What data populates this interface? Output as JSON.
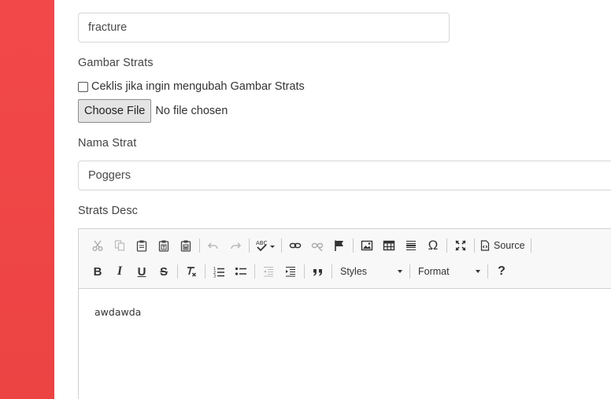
{
  "form": {
    "map_value": "fracture",
    "gambar_label": "Gambar Strats",
    "checkbox_label": "Ceklis jika ingin mengubah Gambar Strats",
    "file_button_label": "Choose File",
    "file_status": "No file chosen",
    "nama_label": "Nama Strat",
    "nama_value": "Poggers",
    "desc_label": "Strats Desc"
  },
  "editor": {
    "source_label": "Source",
    "styles_label": "Styles",
    "format_label": "Format",
    "help_label": "?",
    "bold_label": "B",
    "italic_label": "I",
    "underline_label": "U",
    "strike_label": "S",
    "omega_label": "Ω",
    "content": "awdawda"
  },
  "colors": {
    "sidebar": "#f2484a",
    "toolbar_bg": "#f8f8f8",
    "border": "#d1d1d1"
  }
}
